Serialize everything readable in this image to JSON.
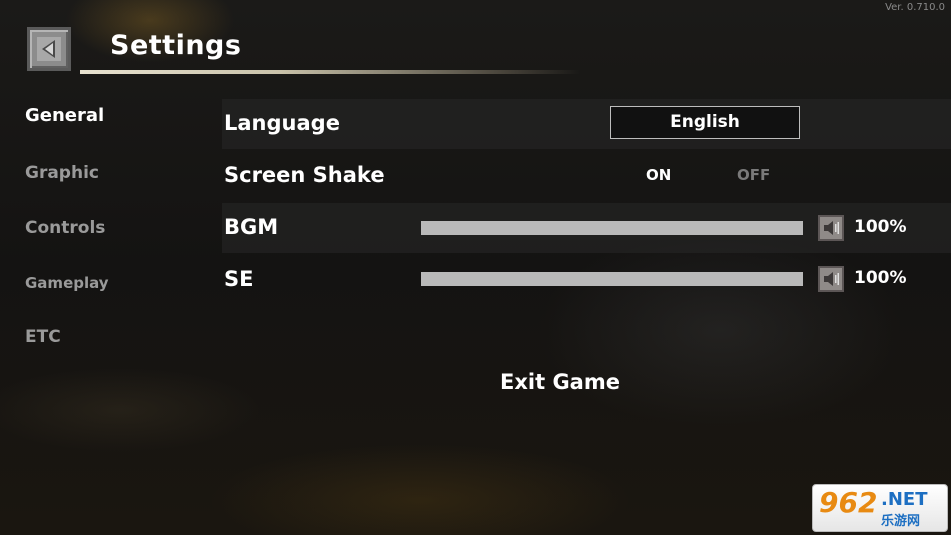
{
  "version": "Ver. 0.710.0",
  "header": {
    "title": "Settings"
  },
  "sidebar": {
    "items": [
      {
        "label": "General",
        "active": true
      },
      {
        "label": "Graphic",
        "active": false
      },
      {
        "label": "Controls",
        "active": false
      },
      {
        "label": "Gameplay",
        "active": false
      },
      {
        "label": "ETC",
        "active": false
      }
    ]
  },
  "settings": {
    "language": {
      "label": "Language",
      "value": "English"
    },
    "screen_shake": {
      "label": "Screen Shake",
      "on_label": "ON",
      "off_label": "OFF",
      "selected": "ON"
    },
    "bgm": {
      "label": "BGM",
      "value_percent": "100%",
      "level": 1.0
    },
    "se": {
      "label": "SE",
      "value_percent": "100%",
      "level": 1.0
    }
  },
  "exit_label": "Exit Game",
  "watermark": {
    "number": "962",
    "domain": ".NET",
    "chinese": "乐游网"
  },
  "icons": {
    "back": "back-arrow-icon",
    "volume": "speaker-icon"
  },
  "colors": {
    "active_text": "#ffffff",
    "inactive_text": "#9a9a9a",
    "slider_fill": "#b9b9b9",
    "watermark_orange": "#e88a12",
    "watermark_blue": "#1d6fc2"
  }
}
